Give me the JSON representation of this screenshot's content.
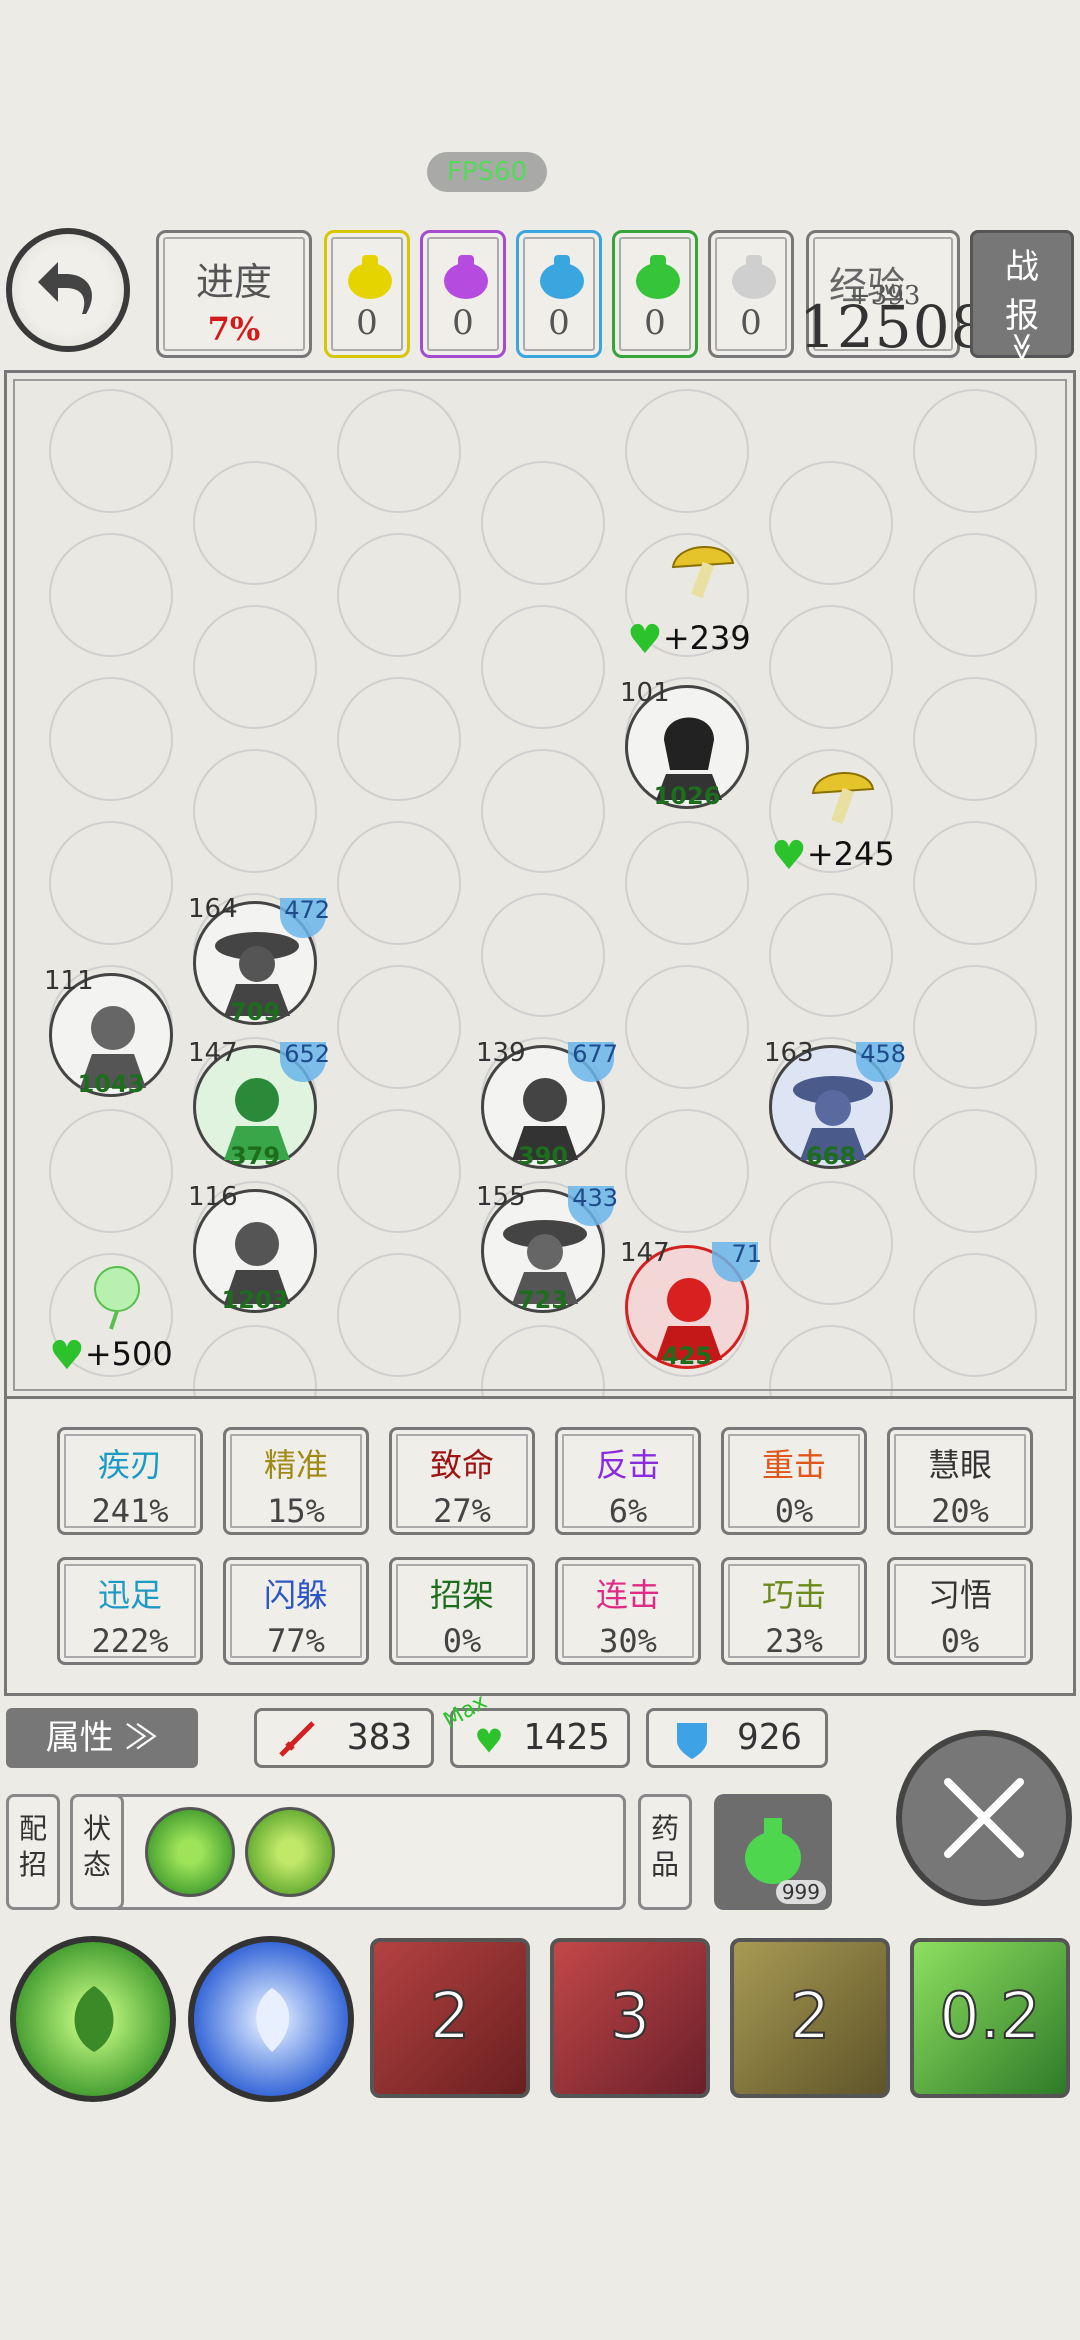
{
  "fps": "FPS60",
  "progress": {
    "label": "进度",
    "value": "7%"
  },
  "bags": [
    {
      "color": "#e5d400",
      "count": "0"
    },
    {
      "color": "#b64be0",
      "count": "0"
    },
    {
      "color": "#3aa6e0",
      "count": "0"
    },
    {
      "color": "#35c43a",
      "count": "0"
    },
    {
      "color": "#bdbdbd",
      "count": "0"
    }
  ],
  "exp": {
    "label": "经验",
    "gain": "+393",
    "value": "12508"
  },
  "battle_report": {
    "line1": "战",
    "line2": "报",
    "arrow": "≫"
  },
  "heroes": [
    {
      "level": "101",
      "hp": "1026",
      "shield": ""
    },
    {
      "level": "164",
      "hp": "709",
      "shield": "472"
    },
    {
      "level": "111",
      "hp": "1043",
      "shield": ""
    },
    {
      "level": "147",
      "hp": "379",
      "shield": "652"
    },
    {
      "level": "139",
      "hp": "390",
      "shield": "677"
    },
    {
      "level": "163",
      "hp": "668",
      "shield": "458"
    },
    {
      "level": "116",
      "hp": "1203",
      "shield": ""
    },
    {
      "level": "155",
      "hp": "723",
      "shield": "433"
    },
    {
      "level": "147",
      "hp": "425",
      "shield": "71"
    }
  ],
  "heals": [
    "+239",
    "+245",
    "+500"
  ],
  "stats": [
    {
      "name": "疾刃",
      "value": "241%",
      "color": "#1b9bc4"
    },
    {
      "name": "精准",
      "value": "15%",
      "color": "#a08a16"
    },
    {
      "name": "致命",
      "value": "27%",
      "color": "#9e1313"
    },
    {
      "name": "反击",
      "value": "6%",
      "color": "#8b2be0"
    },
    {
      "name": "重击",
      "value": "0%",
      "color": "#e0571b"
    },
    {
      "name": "慧眼",
      "value": "20%",
      "color": "#333333"
    },
    {
      "name": "迅足",
      "value": "222%",
      "color": "#1b9bc4"
    },
    {
      "name": "闪躲",
      "value": "77%",
      "color": "#2b56c4"
    },
    {
      "name": "招架",
      "value": "0%",
      "color": "#1c6d1c"
    },
    {
      "name": "连击",
      "value": "30%",
      "color": "#e02b86"
    },
    {
      "name": "巧击",
      "value": "23%",
      "color": "#6a8a1a"
    },
    {
      "name": "习悟",
      "value": "0%",
      "color": "#333333"
    }
  ],
  "attr_button": "属性 ≫",
  "attack": "383",
  "hp": "1425",
  "hp_tag": "Max",
  "defense": "926",
  "side_buttons": {
    "moves": "配招",
    "status": "状态",
    "potion": "药品"
  },
  "potion_count": "999",
  "skill_cooldowns": [
    "2",
    "3",
    "2",
    "0.2"
  ]
}
